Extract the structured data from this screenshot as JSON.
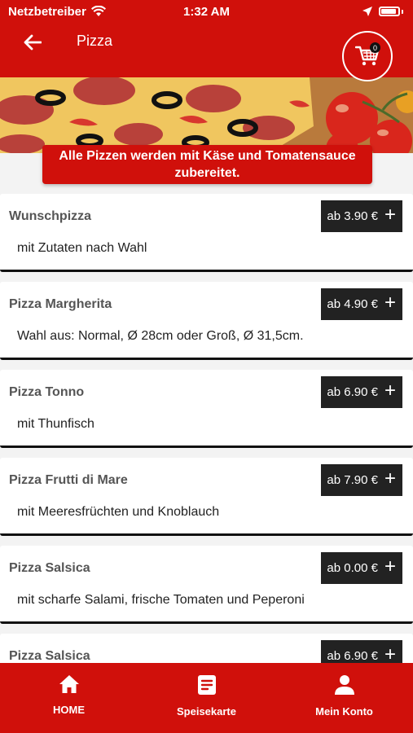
{
  "status_bar": {
    "carrier": "Netzbetreiber",
    "time": "1:32 AM"
  },
  "header": {
    "title": "Pizza",
    "cart_count": "0"
  },
  "notice": "Alle Pizzen werden mit Käse und Tomatensauce zubereitet.",
  "items": [
    {
      "name": "Wunschpizza",
      "price": "ab 3.90 €",
      "description": "mit Zutaten nach Wahl"
    },
    {
      "name": "Pizza Margherita",
      "price": "ab 4.90 €",
      "description": "Wahl aus: Normal, Ø 28cm oder Groß, Ø 31,5cm."
    },
    {
      "name": "Pizza Tonno",
      "price": "ab 6.90 €",
      "description": "mit Thunfisch"
    },
    {
      "name": "Pizza Frutti di Mare",
      "price": "ab 7.90 €",
      "description": "mit Meeresfrüchten und Knoblauch"
    },
    {
      "name": "Pizza Salsica",
      "price": "ab 0.00 €",
      "description": "mit scharfe Salami, frische Tomaten und Peperoni"
    },
    {
      "name": "Pizza Salsica",
      "price": "ab 6.90 €",
      "description": ""
    }
  ],
  "tabs": [
    {
      "label": "HOME",
      "icon": "home-icon"
    },
    {
      "label": "Speisekarte",
      "icon": "menu-card-icon"
    },
    {
      "label": "Mein Konto",
      "icon": "user-icon"
    }
  ],
  "colors": {
    "brand_red": "#d0100b",
    "price_bg": "#222222"
  }
}
